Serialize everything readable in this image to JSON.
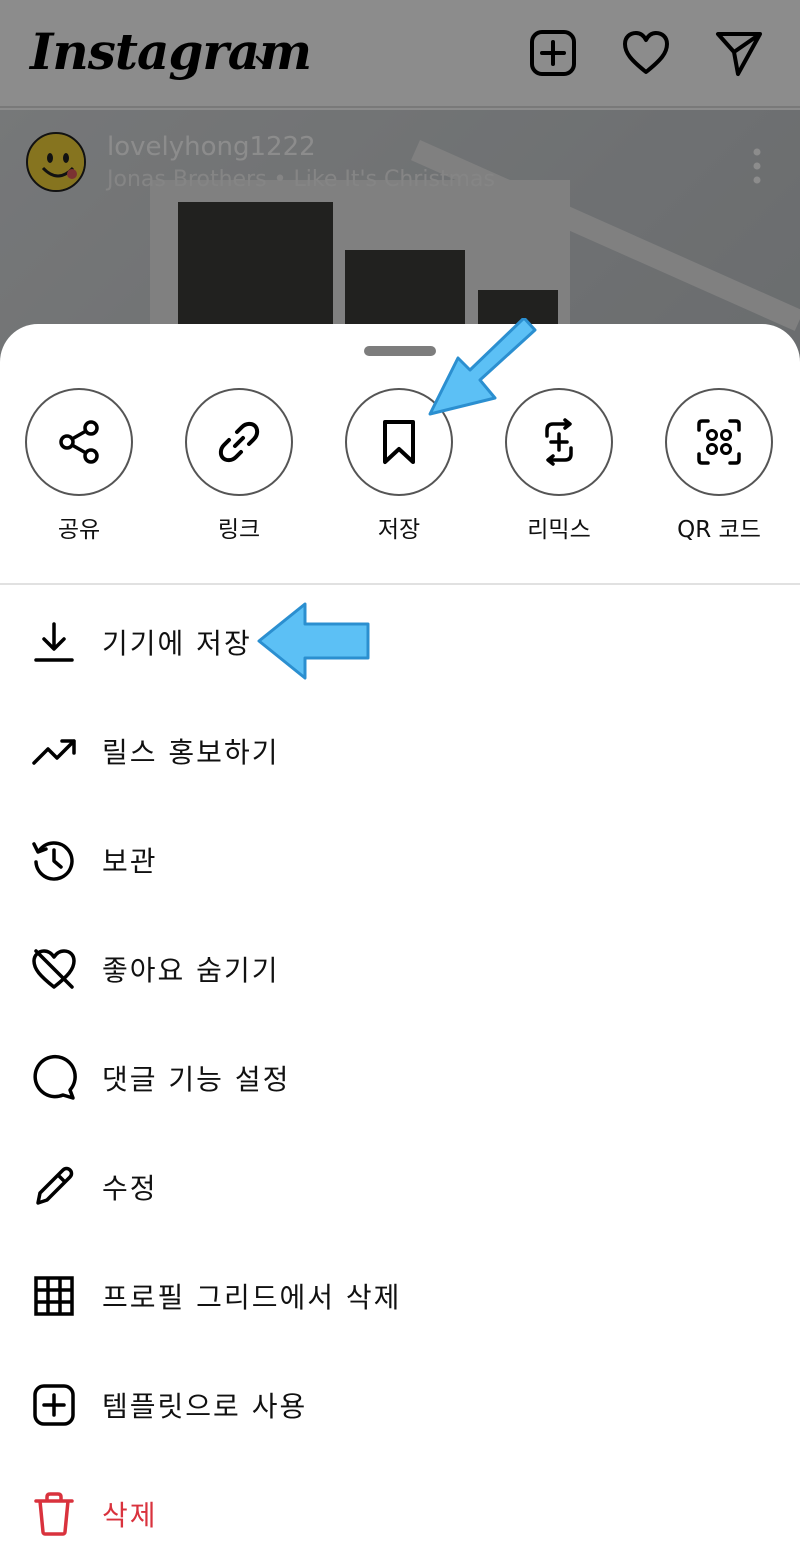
{
  "header": {
    "logo": "Instagram"
  },
  "post": {
    "username": "lovelyhong1222",
    "song": "Jonas Brothers • Like It's Christmas"
  },
  "share_actions": [
    {
      "label": "공유",
      "icon": "share-icon"
    },
    {
      "label": "링크",
      "icon": "link-icon"
    },
    {
      "label": "저장",
      "icon": "bookmark-icon"
    },
    {
      "label": "리믹스",
      "icon": "remix-icon"
    },
    {
      "label": "QR 코드",
      "icon": "qr-code-icon"
    }
  ],
  "menu": [
    {
      "label": "기기에 저장",
      "icon": "download-icon"
    },
    {
      "label": "릴스 홍보하기",
      "icon": "trending-up-icon"
    },
    {
      "label": "보관",
      "icon": "archive-clock-icon"
    },
    {
      "label": "좋아요 숨기기",
      "icon": "hide-likes-heart-icon"
    },
    {
      "label": "댓글 기능 설정",
      "icon": "comment-icon"
    },
    {
      "label": "수정",
      "icon": "pencil-icon"
    },
    {
      "label": "프로필 그리드에서 삭제",
      "icon": "grid-icon"
    },
    {
      "label": "템플릿으로 사용",
      "icon": "plus-square-icon"
    },
    {
      "label": "삭제",
      "icon": "trash-icon"
    }
  ],
  "colors": {
    "danger": "#d9323d",
    "annotation_arrow": "#4fb8f2"
  }
}
